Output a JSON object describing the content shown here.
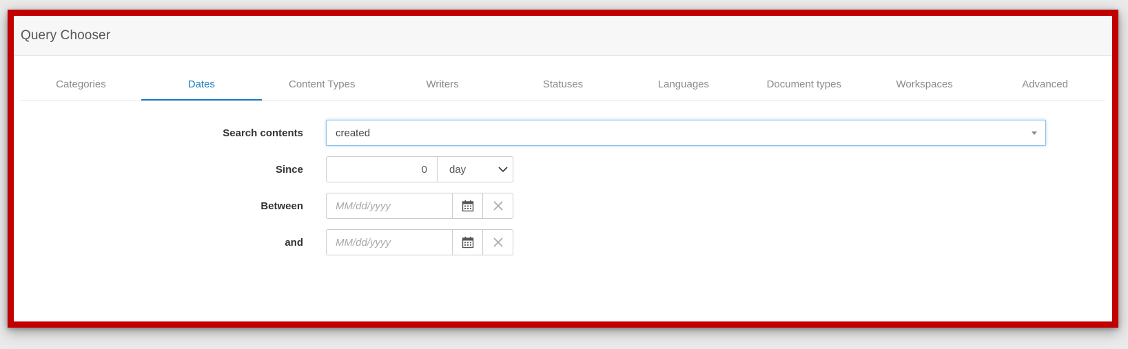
{
  "panel": {
    "title": "Query Chooser"
  },
  "tabs": [
    {
      "label": "Categories",
      "active": false
    },
    {
      "label": "Dates",
      "active": true
    },
    {
      "label": "Content Types",
      "active": false
    },
    {
      "label": "Writers",
      "active": false
    },
    {
      "label": "Statuses",
      "active": false
    },
    {
      "label": "Languages",
      "active": false
    },
    {
      "label": "Document types",
      "active": false
    },
    {
      "label": "Workspaces",
      "active": false
    },
    {
      "label": "Advanced",
      "active": false
    }
  ],
  "form": {
    "search_contents": {
      "label": "Search contents",
      "value": "created"
    },
    "since": {
      "label": "Since",
      "value": "0",
      "unit": "day"
    },
    "between": {
      "label": "Between",
      "placeholder": "MM/dd/yyyy"
    },
    "and": {
      "label": "and",
      "placeholder": "MM/dd/yyyy"
    }
  },
  "colors": {
    "frame": "#c00000",
    "active_tab": "#1a7cc1"
  },
  "icons": {
    "calendar": "calendar-icon",
    "clear": "close-icon",
    "dropdown": "chevron-down-icon"
  }
}
